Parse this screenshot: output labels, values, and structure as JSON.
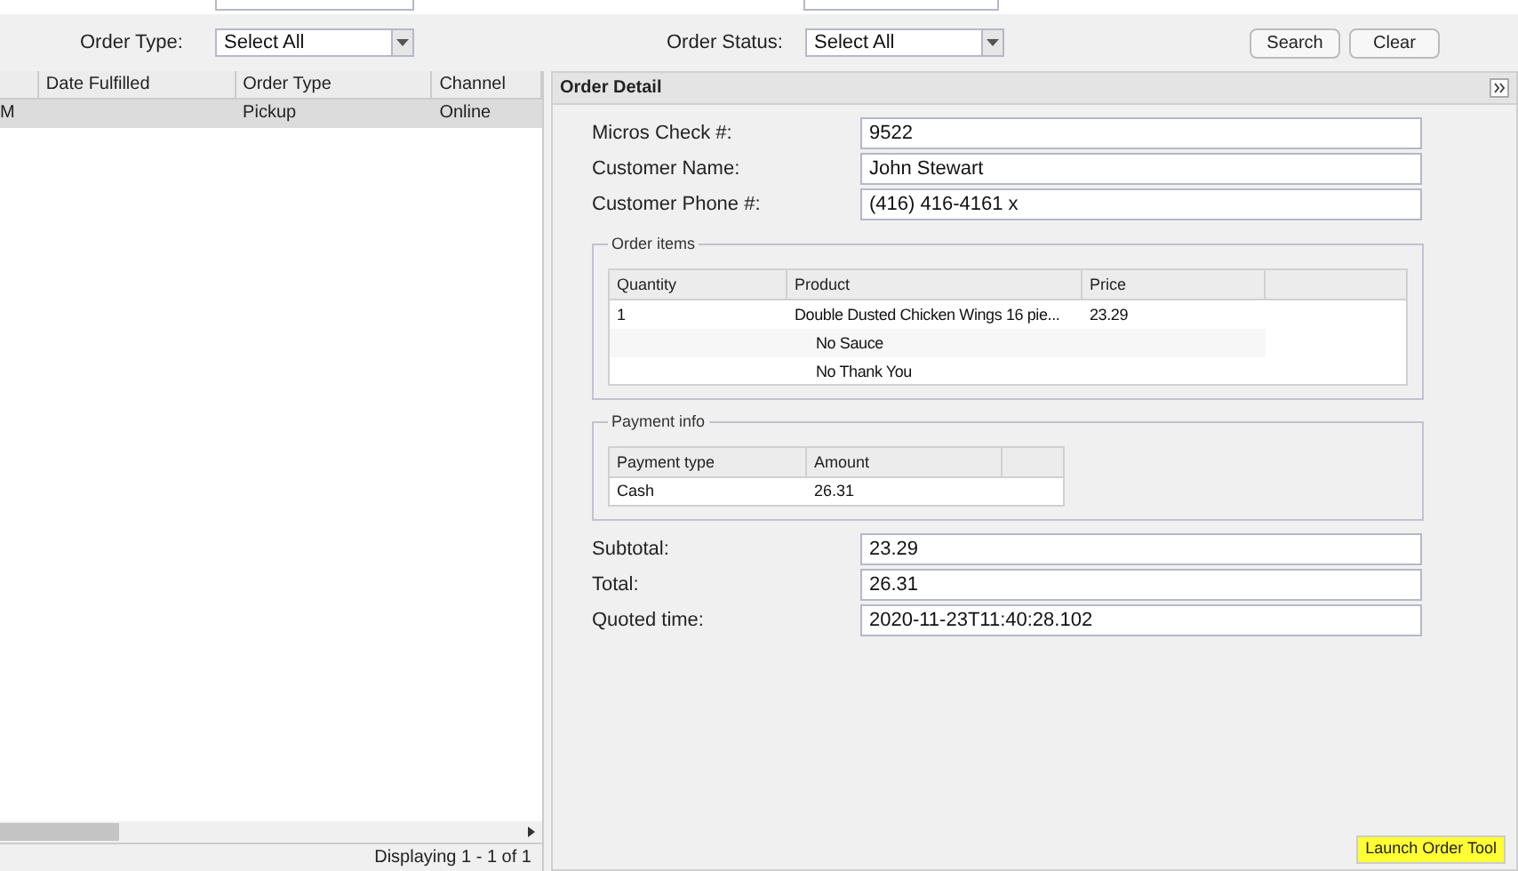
{
  "filters": [
    {
      "label": "Order Type:",
      "value": "Select All"
    },
    {
      "label": "Order Status:",
      "value": "Select All"
    }
  ],
  "buttons": [
    "Search",
    "Clear"
  ],
  "orders_grid": {
    "columns": [
      "",
      "Date Fulfilled",
      "Order Type",
      "Channel"
    ],
    "rows": [
      {
        "cells": [
          "M",
          "",
          "Pickup",
          "Online"
        ],
        "selected": true
      }
    ],
    "footer": "Displaying 1 - 1 of 1"
  },
  "order_detail": {
    "title": "Order Detail",
    "fields": [
      {
        "label": "Micros Check #:",
        "value": "9522"
      },
      {
        "label": "Customer Name:",
        "value": "John Stewart"
      },
      {
        "label": "Customer Phone #:",
        "value": "(416) 416-4161 x"
      }
    ],
    "order_items": {
      "legend": "Order items",
      "columns": [
        "Quantity",
        "Product",
        "Price"
      ],
      "rows": [
        {
          "kind": "item",
          "cells": [
            "1",
            "Double Dusted Chicken Wings 16 pie...",
            "23.29"
          ]
        },
        {
          "kind": "modifier",
          "cells": [
            "",
            "No Sauce",
            ""
          ]
        },
        {
          "kind": "modifier",
          "cells": [
            "",
            "No Thank You",
            ""
          ]
        }
      ]
    },
    "payment_info": {
      "legend": "Payment info",
      "columns": [
        "Payment type",
        "Amount"
      ],
      "rows": [
        {
          "cells": [
            "Cash",
            "26.31"
          ]
        }
      ]
    },
    "totals": [
      {
        "label": "Subtotal:",
        "value": "23.29"
      },
      {
        "label": "Total:",
        "value": "26.31"
      },
      {
        "label": "Quoted time:",
        "value": "2020-11-23T11:40:28.102"
      }
    ],
    "launch_button": "Launch Order Tool"
  }
}
